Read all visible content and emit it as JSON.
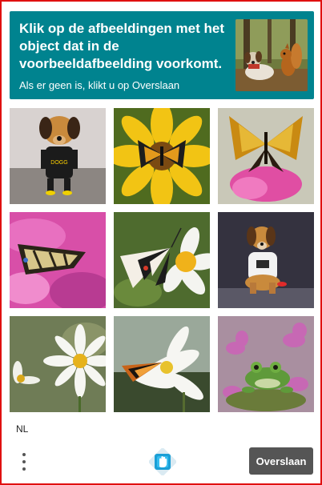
{
  "header": {
    "title": "Klik op de afbeeldingen met het object dat in de voorbeeldafbeelding voorkomt.",
    "subtitle": "Als er geen is, klikt u op Overslaan",
    "sample_image": "dog-and-squirrel-in-forest"
  },
  "tiles": [
    {
      "content": "dog-wearing-shirt",
      "shirt_text": "DOGG"
    },
    {
      "content": "butterfly-on-yellow-flower"
    },
    {
      "content": "butterfly-on-pink-flower"
    },
    {
      "content": "butterfly-on-pink-petals"
    },
    {
      "content": "butterfly-on-white-flower"
    },
    {
      "content": "dog-wearing-shirt"
    },
    {
      "content": "white-daisy-flower"
    },
    {
      "content": "butterfly-on-white-flower"
    },
    {
      "content": "frog-among-pink-flowers"
    }
  ],
  "footer": {
    "language": "NL",
    "skip_label": "Overslaan",
    "menu_icon": "vertical-dots-icon",
    "logo_icon": "hcaptcha-hand-icon"
  },
  "colors": {
    "header_bg": "#00838f",
    "frame_border": "#e01010",
    "skip_bg": "#555555"
  }
}
